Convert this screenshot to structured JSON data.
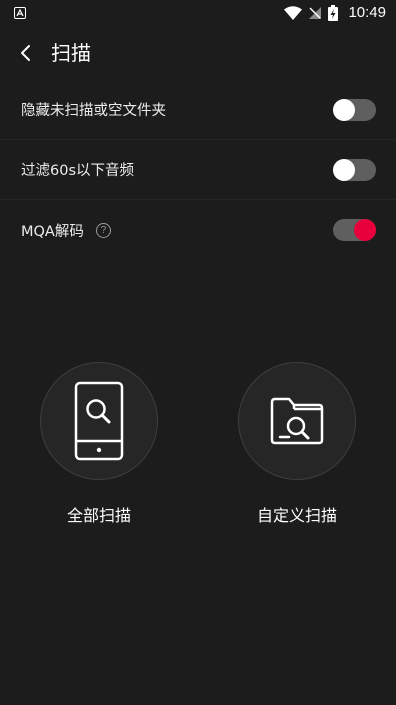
{
  "status_bar": {
    "time": "10:49",
    "icons": [
      "app-notification-icon",
      "wifi-icon",
      "no-sim-icon",
      "battery-charging-icon"
    ]
  },
  "header": {
    "title": "扫描",
    "back_icon": "back-arrow-icon"
  },
  "settings": [
    {
      "label": "隐藏未扫描或空文件夹",
      "toggle": "off"
    },
    {
      "label": "过滤60s以下音频",
      "toggle": "off"
    },
    {
      "label": "MQA解码",
      "toggle": "on",
      "help": "?"
    }
  ],
  "scan_options": [
    {
      "label": "全部扫描",
      "icon": "phone-search-icon"
    },
    {
      "label": "自定义扫描",
      "icon": "folder-search-icon"
    }
  ],
  "colors": {
    "background": "#1c1c1c",
    "accent": "#e8003d",
    "toggle_track": "#5f5f5f"
  }
}
